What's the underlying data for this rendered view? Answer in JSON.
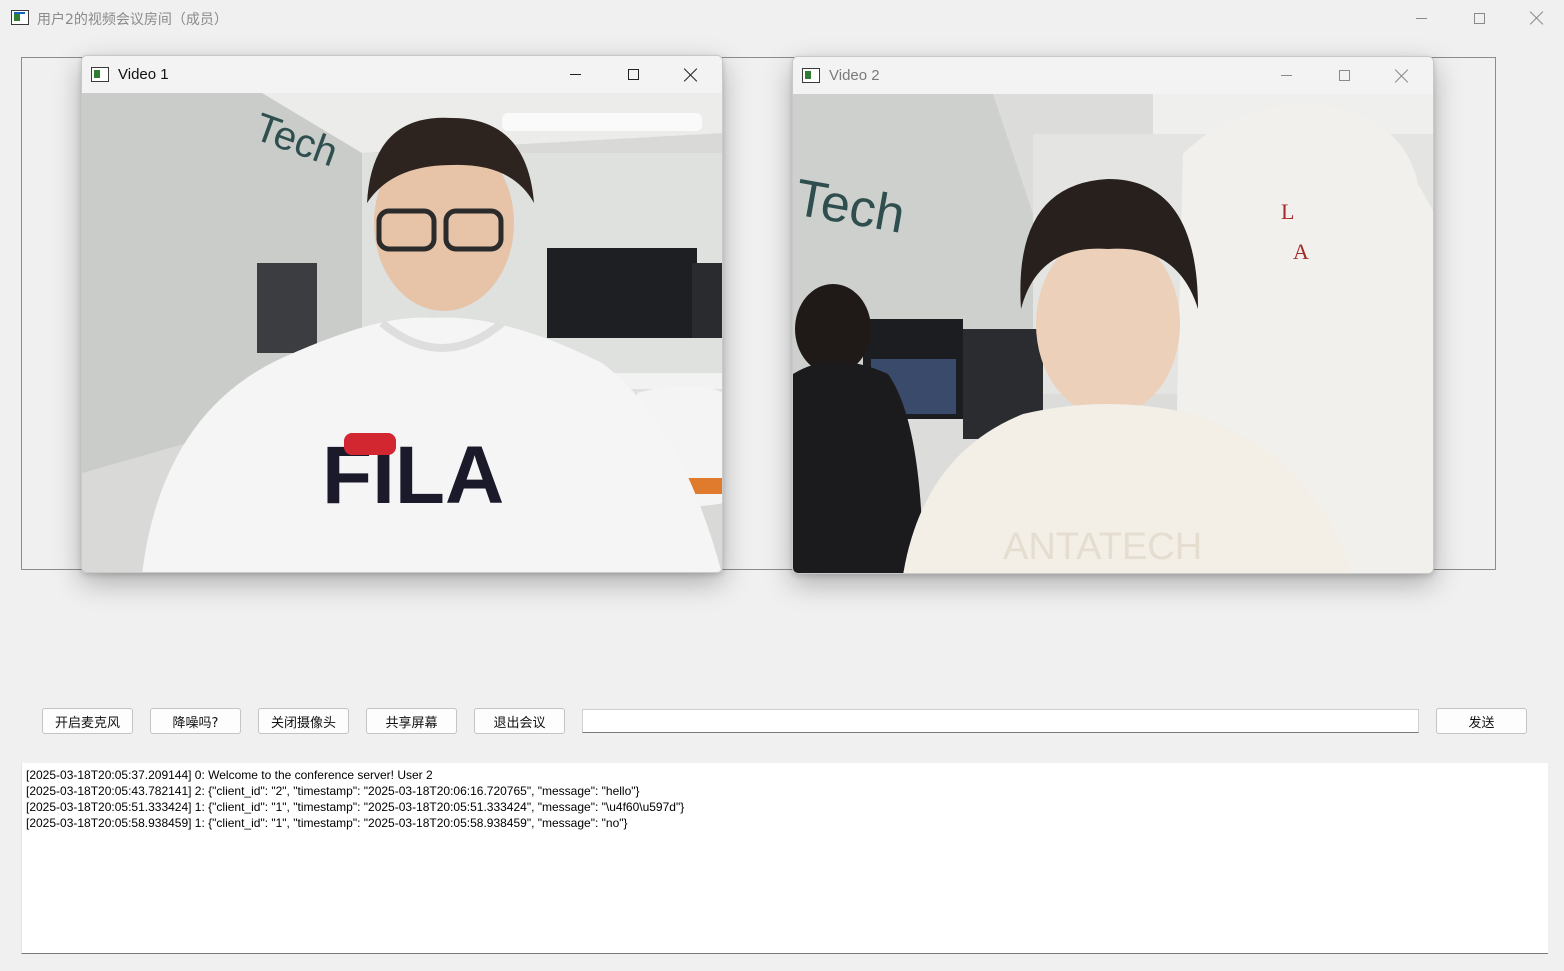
{
  "window": {
    "title": "用户2的视频会议房间（成员）"
  },
  "videos": [
    {
      "title": "Video 1",
      "active": true
    },
    {
      "title": "Video 2",
      "active": false
    }
  ],
  "controls": {
    "mic_label": "开启麦克风",
    "noise_label": "降噪吗?",
    "camera_label": "关闭摄像头",
    "share_label": "共享屏幕",
    "exit_label": "退出会议",
    "send_label": "发送",
    "message_value": ""
  },
  "log": [
    "[2025-03-18T20:05:37.209144] 0: Welcome to the conference server! User 2",
    "[2025-03-18T20:05:43.782141] 2: {\"client_id\": \"2\", \"timestamp\": \"2025-03-18T20:06:16.720765\", \"message\": \"hello\"}",
    "[2025-03-18T20:05:51.333424] 1: {\"client_id\": \"1\", \"timestamp\": \"2025-03-18T20:05:51.333424\", \"message\": \"\\u4f60\\u597d\"}",
    "[2025-03-18T20:05:58.938459] 1: {\"client_id\": \"1\", \"timestamp\": \"2025-03-18T20:05:58.938459\", \"message\": \"no\"}"
  ],
  "icons": [
    "app-icon",
    "minimize-icon",
    "maximize-icon",
    "close-icon"
  ],
  "colors": {
    "background": "#f0f0f0",
    "log_background": "#ffffff",
    "inactive_title": "#8a8a8a"
  }
}
